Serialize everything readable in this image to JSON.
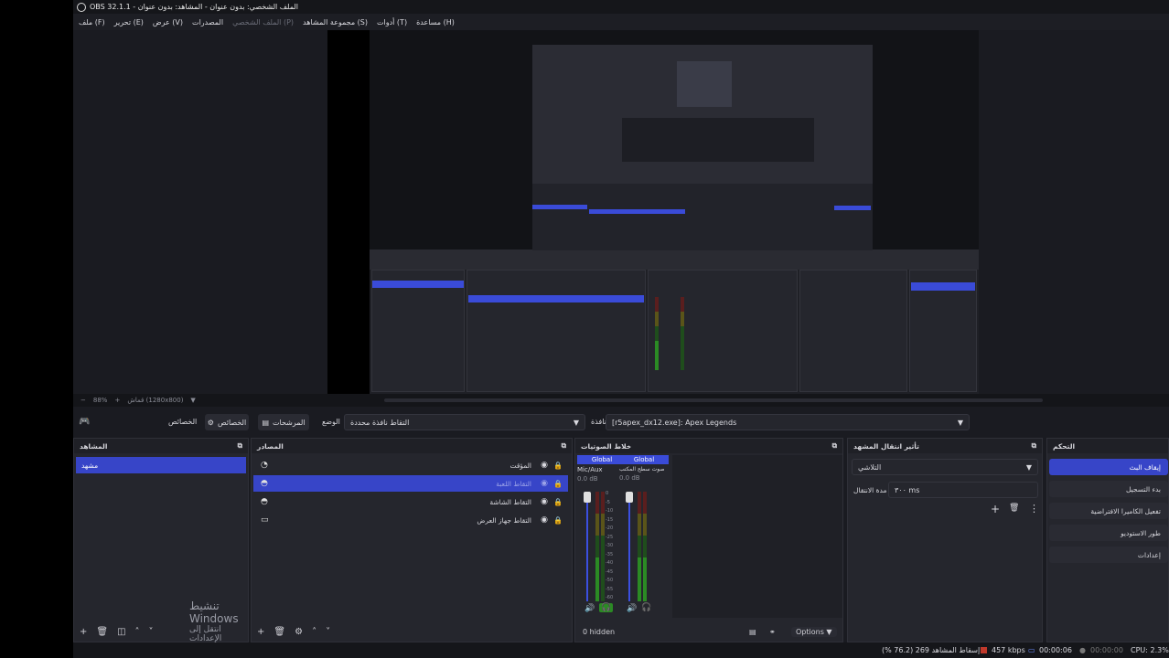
{
  "window": {
    "title": "OBS 32.1.1 - الملف الشخصي: بدون عنوان - المشاهد: بدون عنوان"
  },
  "menu": [
    "ملف (F)",
    "تحرير (E)",
    "عرض (V)",
    "المصدرات",
    "الملف الشخصي (P)",
    "مجموعة المشاهد (S)",
    "أدوات (T)",
    "مساعدة (H)"
  ],
  "zoom": {
    "level": "88%",
    "label": "قماش (1280x800)"
  },
  "toolbar": {
    "properties_label": "الخصائص",
    "filters_label": "المرشحات",
    "mode_label": "الوضع",
    "mode_value": "التقاط نافذة محددة",
    "window_label": "نافذة",
    "window_value": "[r5apex_dx12.exe]: Apex Legends",
    "icon_left": "game-controller-icon"
  },
  "scenes": {
    "title": "المشاهد",
    "items": [
      "مشهد"
    ]
  },
  "sources": {
    "title": "المصادر",
    "items": [
      {
        "label": "المؤقت",
        "icon": "timer-icon",
        "selected": false
      },
      {
        "label": "التقاط اللعبة",
        "icon": "gamepad-icon",
        "selected": true
      },
      {
        "label": "التقاط الشاشة",
        "icon": "display-icon",
        "selected": false
      },
      {
        "label": "التقاط جهاز العرض",
        "icon": "monitor-icon",
        "selected": false
      }
    ]
  },
  "mixer": {
    "title": "خلاط الصوتيات",
    "channels": [
      {
        "header": "Global",
        "name": "Mic/Aux",
        "db": "0.0 dB"
      },
      {
        "header": "Global",
        "name": "صوت سطح المكتب",
        "db": "0.0 dB"
      }
    ],
    "scale": [
      "0",
      "-5",
      "-10",
      "-15",
      "-20",
      "-25",
      "-30",
      "-35",
      "-40",
      "-45",
      "-50",
      "-55",
      "-60"
    ],
    "hidden": "0 hidden",
    "options": "Options"
  },
  "transitions": {
    "title": "تأثير انتقال المشهد",
    "type": "التلاشي",
    "duration_label": "مدة الانتقال",
    "duration_value": "٣٠٠ ms"
  },
  "controls": {
    "title": "التحكم",
    "buttons": [
      "إيقاف البث",
      "بدء التسجيل",
      "تفعيل الكاميرا الافتراضية",
      "طور الاستوديو",
      "إعدادات"
    ],
    "active_color": "#3745c8"
  },
  "status": {
    "dropped": "إسقاط المشاهد 269 (76.2 %)",
    "bitrate": "457 kbps",
    "stream_time": "00:00:06",
    "rec_time": "00:00:00",
    "cpu": "CPU: 2.3%"
  },
  "watermark": {
    "line1": "تنشيط Windows",
    "line2": "انتقل إلى الإعدادات لتنشيط Windows"
  }
}
